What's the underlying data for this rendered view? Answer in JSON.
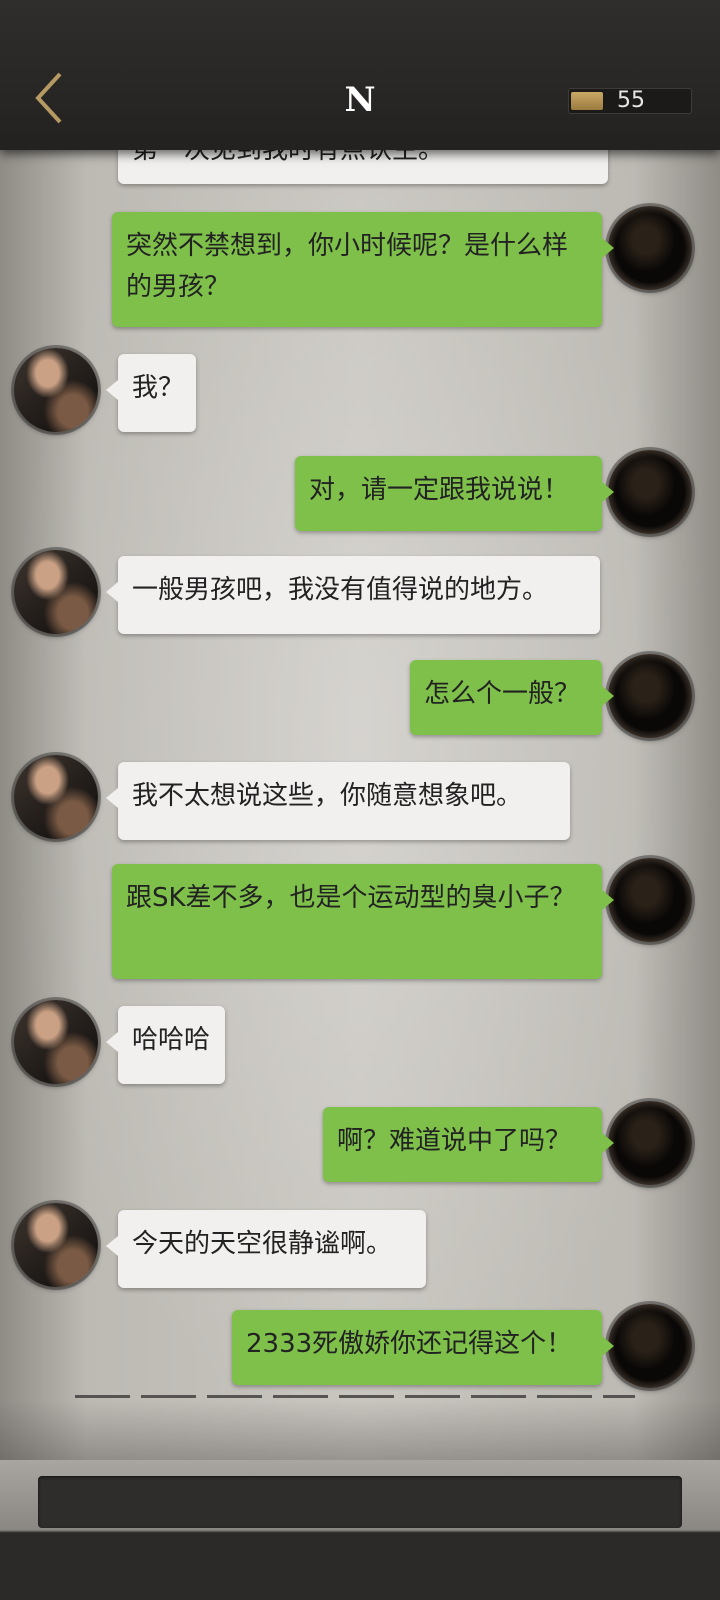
{
  "header": {
    "title": "N",
    "coins": "55",
    "back_icon": "chevron-left-icon",
    "coin_icon": "coin-bar-icon",
    "accent_color": "#c9a866"
  },
  "chat": {
    "messages": [
      {
        "side": "in",
        "text": "第一次见到我时有点认生。",
        "partially_visible": true
      },
      {
        "side": "out",
        "text": "突然不禁想到，你小时候呢？是什么样的男孩？"
      },
      {
        "side": "in",
        "text": "我？"
      },
      {
        "side": "out",
        "text": "对，请一定跟我说说！"
      },
      {
        "side": "in",
        "text": "一般男孩吧，我没有值得说的地方。"
      },
      {
        "side": "out",
        "text": "怎么个一般？"
      },
      {
        "side": "in",
        "text": "我不太想说这些，你随意想象吧。"
      },
      {
        "side": "out",
        "text": "跟SK差不多，也是个运动型的臭小子？"
      },
      {
        "side": "in",
        "text": "哈哈哈"
      },
      {
        "side": "out",
        "text": "啊？难道说中了吗？"
      },
      {
        "side": "in",
        "text": "今天的天空很静谧啊。"
      },
      {
        "side": "out",
        "text": "2333死傲娇你还记得这个！"
      }
    ],
    "in_bubble_color": "#f1f0ee",
    "out_bubble_color": "#7ec04a"
  },
  "input": {
    "placeholder": ""
  }
}
